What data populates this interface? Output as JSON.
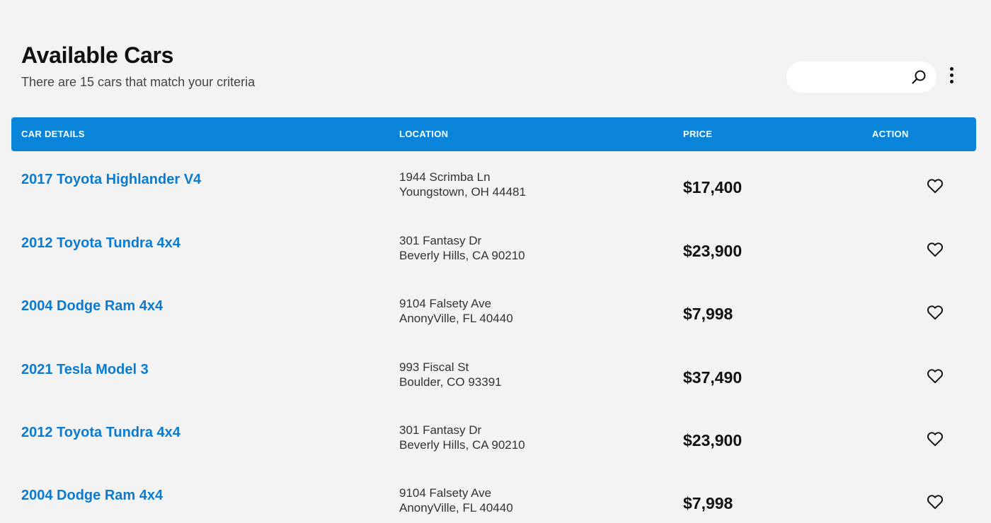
{
  "header": {
    "title": "Available Cars",
    "subtitle": "There are 15 cars that match your criteria"
  },
  "search": {
    "placeholder": "",
    "value": ""
  },
  "icons": {
    "search": "search-icon",
    "menu": "more-vertical-icon",
    "favorite": "heart-outline-icon"
  },
  "colors": {
    "accent": "#0a84d9",
    "link": "#0a7bd0",
    "background": "#f3f3f3"
  },
  "table": {
    "columns": [
      "CAR DETAILS",
      "LOCATION",
      "PRICE",
      "ACTION"
    ],
    "rows": [
      {
        "name": "2017 Toyota Highlander V4",
        "address1": "1944 Scrimba Ln",
        "address2": "Youngstown, OH 44481",
        "price": "$17,400"
      },
      {
        "name": "2012 Toyota Tundra 4x4",
        "address1": "301 Fantasy Dr",
        "address2": "Beverly Hills, CA 90210",
        "price": "$23,900"
      },
      {
        "name": "2004 Dodge Ram 4x4",
        "address1": "9104 Falsety Ave",
        "address2": "AnonyVille, FL 40440",
        "price": "$7,998"
      },
      {
        "name": "2021 Tesla Model 3",
        "address1": "993 Fiscal St",
        "address2": "Boulder, CO 93391",
        "price": "$37,490"
      },
      {
        "name": "2012 Toyota Tundra 4x4",
        "address1": "301 Fantasy Dr",
        "address2": "Beverly Hills, CA 90210",
        "price": "$23,900"
      },
      {
        "name": "2004 Dodge Ram 4x4",
        "address1": "9104 Falsety Ave",
        "address2": "AnonyVille, FL 40440",
        "price": "$7,998"
      }
    ]
  }
}
